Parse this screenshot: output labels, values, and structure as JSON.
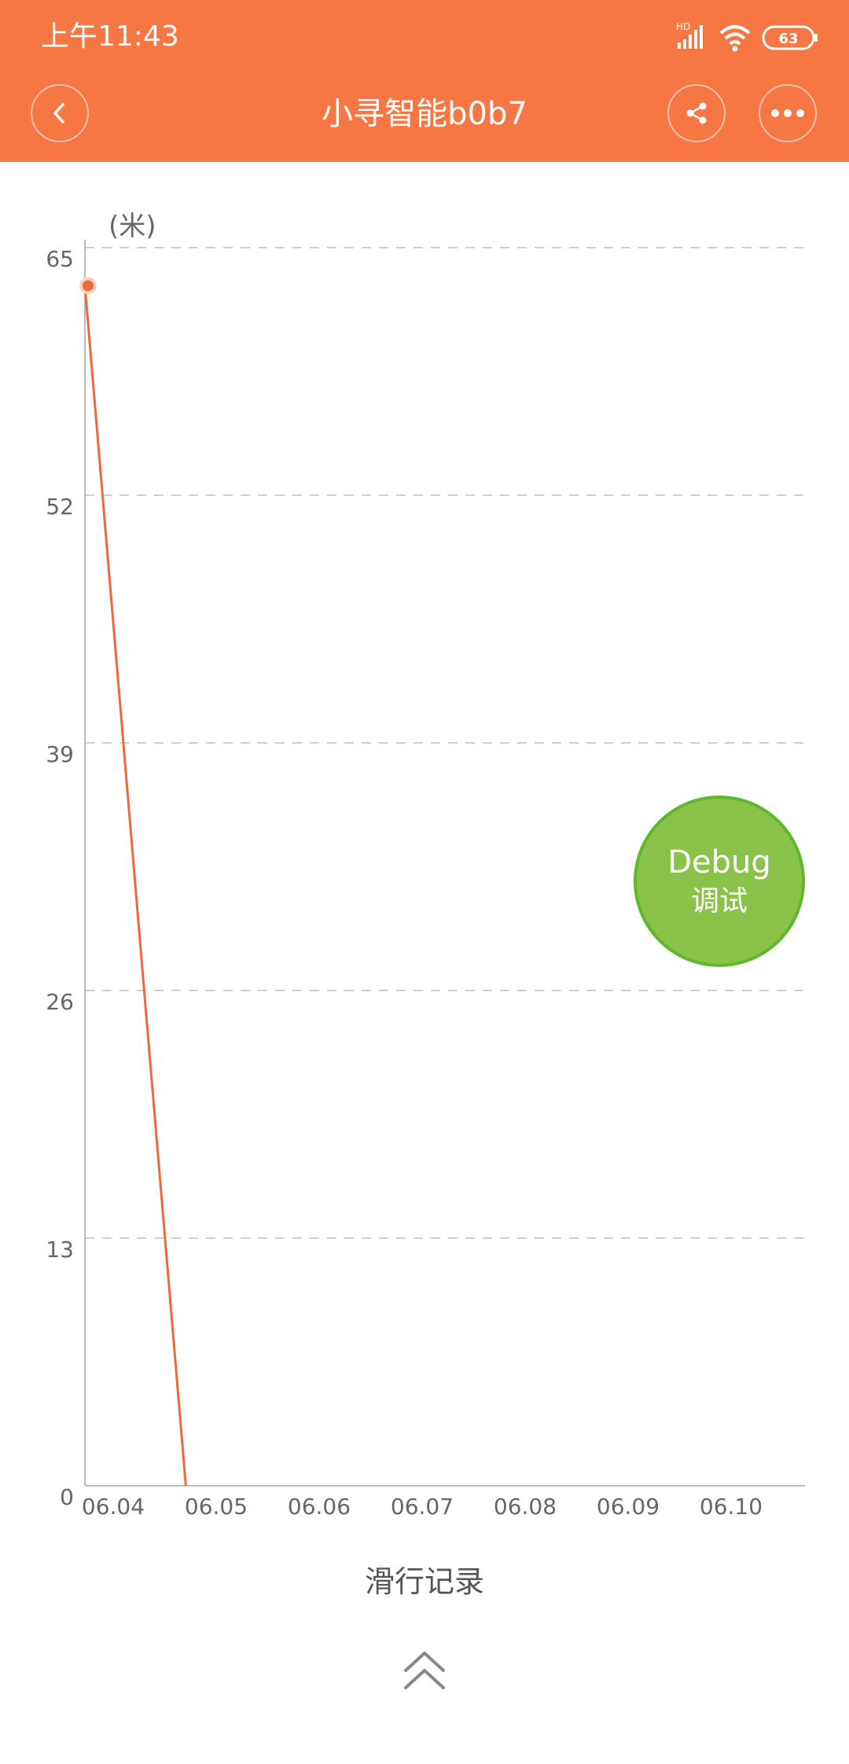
{
  "status_bar": {
    "time": "上午11:43",
    "network_badge": "HD",
    "battery": "63",
    "icons": [
      "signal-icon",
      "wifi-icon",
      "battery-icon"
    ]
  },
  "app_bar": {
    "title": "小寻智能b0b7",
    "background_color": "#f77744",
    "icons": [
      "back-icon",
      "share-icon",
      "more-icon"
    ]
  },
  "chart_data": {
    "type": "line",
    "title": "滑行记录",
    "xlabel": "",
    "ylabel": "(米)",
    "x_categories": [
      "06.04",
      "06.05",
      "06.06",
      "06.07",
      "06.08",
      "06.09",
      "06.10"
    ],
    "y_ticks": [
      "65",
      "52",
      "39",
      "26",
      "13",
      "0"
    ],
    "ylim": [
      0,
      65
    ],
    "grid": true,
    "color": "#f0673c",
    "series": [
      {
        "points": [
          {
            "x": 0,
            "y": 63
          },
          {
            "x": 0.98,
            "y": 0
          }
        ]
      }
    ]
  },
  "debug_button": {
    "line1": "Debug",
    "line2": "调试",
    "color": "#8bc34a"
  },
  "footer": {
    "expand_icon": "double-chevron-up-icon"
  }
}
